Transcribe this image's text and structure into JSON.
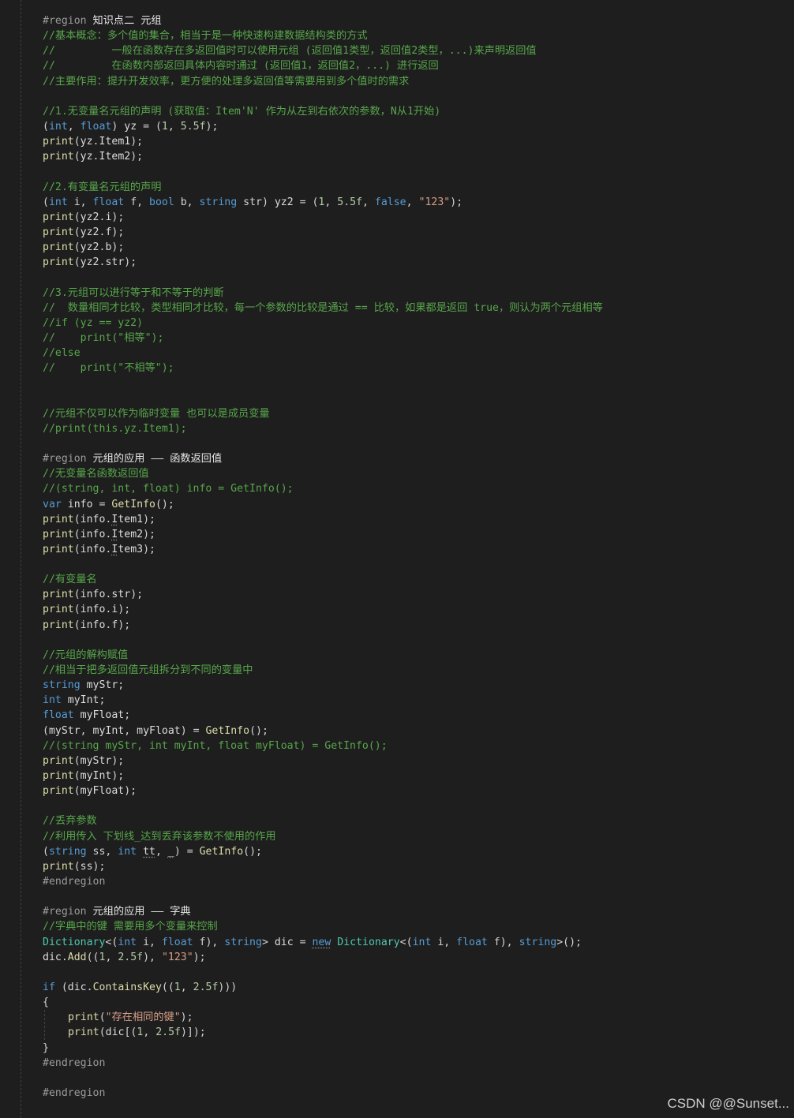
{
  "editor": {
    "lines": [
      {
        "type": "region",
        "prefix": "#region ",
        "name": "知识点二 元组"
      },
      {
        "type": "comment",
        "text": "//基本概念：多个值的集合，相当于是一种快速构建数据结构类的方式"
      },
      {
        "type": "comment",
        "text": "//         一般在函数存在多返回值时可以使用元组 (返回值1类型，返回值2类型，...)来声明返回值"
      },
      {
        "type": "comment",
        "text": "//         在函数内部返回具体内容时通过 (返回值1，返回值2，...) 进行返回"
      },
      {
        "type": "comment",
        "text": "//主要作用：提升开发效率，更方便的处理多返回值等需要用到多个值时的需求"
      },
      {
        "type": "blank"
      },
      {
        "type": "comment",
        "text": "//1.无变量名元组的声明 (获取值：Item'N' 作为从左到右依次的参数，N从1开始)"
      },
      {
        "type": "code",
        "tokens": [
          [
            "p",
            "("
          ],
          [
            "k",
            "int"
          ],
          [
            "p",
            ", "
          ],
          [
            "k",
            "float"
          ],
          [
            "p",
            ") "
          ],
          [
            "v",
            "yz"
          ],
          [
            "p",
            " = ("
          ],
          [
            "n",
            "1"
          ],
          [
            "p",
            ", "
          ],
          [
            "n",
            "5.5f"
          ],
          [
            "p",
            ");"
          ]
        ]
      },
      {
        "type": "code",
        "tokens": [
          [
            "f",
            "print"
          ],
          [
            "p",
            "("
          ],
          [
            "v",
            "yz"
          ],
          [
            "p",
            "."
          ],
          [
            "v",
            "Item1"
          ],
          [
            "p",
            ");"
          ]
        ]
      },
      {
        "type": "code",
        "tokens": [
          [
            "f",
            "print"
          ],
          [
            "p",
            "("
          ],
          [
            "v",
            "yz"
          ],
          [
            "p",
            "."
          ],
          [
            "v",
            "Item2"
          ],
          [
            "p",
            ");"
          ]
        ]
      },
      {
        "type": "blank"
      },
      {
        "type": "comment",
        "text": "//2.有变量名元组的声明"
      },
      {
        "type": "code",
        "tokens": [
          [
            "p",
            "("
          ],
          [
            "k",
            "int"
          ],
          [
            "p",
            " i, "
          ],
          [
            "k",
            "float"
          ],
          [
            "p",
            " f, "
          ],
          [
            "k",
            "bool"
          ],
          [
            "p",
            " b, "
          ],
          [
            "k",
            "string"
          ],
          [
            "p",
            " str) "
          ],
          [
            "v",
            "yz2"
          ],
          [
            "p",
            " = ("
          ],
          [
            "n",
            "1"
          ],
          [
            "p",
            ", "
          ],
          [
            "n",
            "5.5f"
          ],
          [
            "p",
            ", "
          ],
          [
            "k",
            "false"
          ],
          [
            "p",
            ", "
          ],
          [
            "s",
            "\"123\""
          ],
          [
            "p",
            ");"
          ]
        ]
      },
      {
        "type": "code",
        "tokens": [
          [
            "f",
            "print"
          ],
          [
            "p",
            "("
          ],
          [
            "v",
            "yz2"
          ],
          [
            "p",
            "."
          ],
          [
            "v",
            "i"
          ],
          [
            "p",
            ");"
          ]
        ]
      },
      {
        "type": "code",
        "tokens": [
          [
            "f",
            "print"
          ],
          [
            "p",
            "("
          ],
          [
            "v",
            "yz2"
          ],
          [
            "p",
            "."
          ],
          [
            "v",
            "f"
          ],
          [
            "p",
            ");"
          ]
        ]
      },
      {
        "type": "code",
        "tokens": [
          [
            "f",
            "print"
          ],
          [
            "p",
            "("
          ],
          [
            "v",
            "yz2"
          ],
          [
            "p",
            "."
          ],
          [
            "v",
            "b"
          ],
          [
            "p",
            ");"
          ]
        ]
      },
      {
        "type": "code",
        "tokens": [
          [
            "f",
            "print"
          ],
          [
            "p",
            "("
          ],
          [
            "v",
            "yz2"
          ],
          [
            "p",
            "."
          ],
          [
            "v",
            "str"
          ],
          [
            "p",
            ");"
          ]
        ]
      },
      {
        "type": "blank"
      },
      {
        "type": "comment",
        "text": "//3.元组可以进行等于和不等于的判断"
      },
      {
        "type": "comment",
        "text": "//  数量相同才比较，类型相同才比较，每一个参数的比较是通过 == 比较，如果都是返回 true，则认为两个元组相等"
      },
      {
        "type": "comment",
        "text": "//if (yz == yz2)"
      },
      {
        "type": "comment",
        "text": "//    print(\"相等\");"
      },
      {
        "type": "comment",
        "text": "//else"
      },
      {
        "type": "comment",
        "text": "//    print(\"不相等\");"
      },
      {
        "type": "blank"
      },
      {
        "type": "blank"
      },
      {
        "type": "comment",
        "text": "//元组不仅可以作为临时变量 也可以是成员变量"
      },
      {
        "type": "comment",
        "text": "//print(this.yz.Item1);"
      },
      {
        "type": "blank"
      },
      {
        "type": "region",
        "prefix": "#region ",
        "name": "元组的应用 —— 函数返回值"
      },
      {
        "type": "comment",
        "text": "//无变量名函数返回值"
      },
      {
        "type": "comment",
        "text": "//(string, int, float) info = GetInfo();"
      },
      {
        "type": "code",
        "tokens": [
          [
            "k",
            "var"
          ],
          [
            "p",
            " "
          ],
          [
            "v",
            "info"
          ],
          [
            "p",
            " = "
          ],
          [
            "f",
            "GetInfo"
          ],
          [
            "p",
            "();"
          ]
        ]
      },
      {
        "type": "code",
        "tokens": [
          [
            "f",
            "print"
          ],
          [
            "p",
            "("
          ],
          [
            "v",
            "info"
          ],
          [
            "p",
            "."
          ],
          [
            "vs",
            "I"
          ],
          [
            "v",
            "tem1"
          ],
          [
            "p",
            ");"
          ]
        ]
      },
      {
        "type": "code",
        "tokens": [
          [
            "f",
            "print"
          ],
          [
            "p",
            "("
          ],
          [
            "v",
            "info"
          ],
          [
            "p",
            "."
          ],
          [
            "vs",
            "I"
          ],
          [
            "v",
            "tem2"
          ],
          [
            "p",
            ");"
          ]
        ]
      },
      {
        "type": "code",
        "tokens": [
          [
            "f",
            "print"
          ],
          [
            "p",
            "("
          ],
          [
            "v",
            "info"
          ],
          [
            "p",
            "."
          ],
          [
            "vs",
            "I"
          ],
          [
            "v",
            "tem3"
          ],
          [
            "p",
            ");"
          ]
        ]
      },
      {
        "type": "blank"
      },
      {
        "type": "comment",
        "text": "//有变量名"
      },
      {
        "type": "code",
        "tokens": [
          [
            "f",
            "print"
          ],
          [
            "p",
            "("
          ],
          [
            "v",
            "info"
          ],
          [
            "p",
            "."
          ],
          [
            "v",
            "str"
          ],
          [
            "p",
            ");"
          ]
        ]
      },
      {
        "type": "code",
        "tokens": [
          [
            "f",
            "print"
          ],
          [
            "p",
            "("
          ],
          [
            "v",
            "info"
          ],
          [
            "p",
            "."
          ],
          [
            "v",
            "i"
          ],
          [
            "p",
            ");"
          ]
        ]
      },
      {
        "type": "code",
        "tokens": [
          [
            "f",
            "print"
          ],
          [
            "p",
            "("
          ],
          [
            "v",
            "info"
          ],
          [
            "p",
            "."
          ],
          [
            "v",
            "f"
          ],
          [
            "p",
            ");"
          ]
        ]
      },
      {
        "type": "blank"
      },
      {
        "type": "comment",
        "text": "//元组的解构赋值"
      },
      {
        "type": "comment",
        "text": "//相当于把多返回值元组拆分到不同的变量中"
      },
      {
        "type": "code",
        "tokens": [
          [
            "k",
            "string"
          ],
          [
            "p",
            " "
          ],
          [
            "v",
            "myStr"
          ],
          [
            "p",
            ";"
          ]
        ]
      },
      {
        "type": "code",
        "tokens": [
          [
            "k",
            "int"
          ],
          [
            "p",
            " "
          ],
          [
            "v",
            "myInt"
          ],
          [
            "p",
            ";"
          ]
        ]
      },
      {
        "type": "code",
        "tokens": [
          [
            "k",
            "float"
          ],
          [
            "p",
            " "
          ],
          [
            "v",
            "myFloat"
          ],
          [
            "p",
            ";"
          ]
        ]
      },
      {
        "type": "code",
        "tokens": [
          [
            "p",
            "("
          ],
          [
            "v",
            "myStr"
          ],
          [
            "p",
            ", "
          ],
          [
            "v",
            "myInt"
          ],
          [
            "p",
            ", "
          ],
          [
            "v",
            "myFloat"
          ],
          [
            "p",
            ") = "
          ],
          [
            "f",
            "GetInfo"
          ],
          [
            "p",
            "();"
          ]
        ]
      },
      {
        "type": "comment",
        "text": "//(string myStr, int myInt, float myFloat) = GetInfo();"
      },
      {
        "type": "code",
        "tokens": [
          [
            "f",
            "print"
          ],
          [
            "p",
            "("
          ],
          [
            "v",
            "myStr"
          ],
          [
            "p",
            ");"
          ]
        ]
      },
      {
        "type": "code",
        "tokens": [
          [
            "f",
            "print"
          ],
          [
            "p",
            "("
          ],
          [
            "v",
            "myInt"
          ],
          [
            "p",
            ");"
          ]
        ]
      },
      {
        "type": "code",
        "tokens": [
          [
            "f",
            "print"
          ],
          [
            "p",
            "("
          ],
          [
            "v",
            "myFloat"
          ],
          [
            "p",
            ");"
          ]
        ]
      },
      {
        "type": "blank"
      },
      {
        "type": "comment",
        "text": "//丢弃参数"
      },
      {
        "type": "comment",
        "text": "//利用传入 下划线_达到丢弃该参数不使用的作用"
      },
      {
        "type": "code",
        "tokens": [
          [
            "p",
            "("
          ],
          [
            "k",
            "string"
          ],
          [
            "p",
            " ss, "
          ],
          [
            "k",
            "int"
          ],
          [
            "p",
            " "
          ],
          [
            "vs",
            "tt"
          ],
          [
            "p",
            ", "
          ],
          [
            "vs",
            "_"
          ],
          [
            "p",
            ") = "
          ],
          [
            "f",
            "GetInfo"
          ],
          [
            "p",
            "();"
          ]
        ]
      },
      {
        "type": "code",
        "tokens": [
          [
            "f",
            "print"
          ],
          [
            "p",
            "("
          ],
          [
            "v",
            "ss"
          ],
          [
            "p",
            ");"
          ]
        ]
      },
      {
        "type": "region",
        "prefix": "#endregion",
        "name": ""
      },
      {
        "type": "blank"
      },
      {
        "type": "region",
        "prefix": "#region ",
        "name": "元组的应用 —— 字典"
      },
      {
        "type": "comment",
        "text": "//字典中的键 需要用多个变量来控制"
      },
      {
        "type": "code",
        "tokens": [
          [
            "t",
            "Dictionary"
          ],
          [
            "p",
            "<("
          ],
          [
            "k",
            "int"
          ],
          [
            "p",
            " i, "
          ],
          [
            "k",
            "float"
          ],
          [
            "p",
            " f), "
          ],
          [
            "k",
            "string"
          ],
          [
            "p",
            "> "
          ],
          [
            "v",
            "dic"
          ],
          [
            "p",
            " = "
          ],
          [
            "ks",
            "new"
          ],
          [
            "p",
            " "
          ],
          [
            "t",
            "Dictionary"
          ],
          [
            "p",
            "<("
          ],
          [
            "k",
            "int"
          ],
          [
            "p",
            " i, "
          ],
          [
            "k",
            "float"
          ],
          [
            "p",
            " f), "
          ],
          [
            "k",
            "string"
          ],
          [
            "p",
            ">();"
          ]
        ]
      },
      {
        "type": "code",
        "tokens": [
          [
            "v",
            "dic"
          ],
          [
            "p",
            "."
          ],
          [
            "f",
            "Add"
          ],
          [
            "p",
            "(("
          ],
          [
            "n",
            "1"
          ],
          [
            "p",
            ", "
          ],
          [
            "n",
            "2.5f"
          ],
          [
            "p",
            "), "
          ],
          [
            "s",
            "\"123\""
          ],
          [
            "p",
            ");"
          ]
        ]
      },
      {
        "type": "blank"
      },
      {
        "type": "code",
        "tokens": [
          [
            "k",
            "if"
          ],
          [
            "p",
            " ("
          ],
          [
            "v",
            "dic"
          ],
          [
            "p",
            "."
          ],
          [
            "f",
            "ContainsKey"
          ],
          [
            "p",
            "(("
          ],
          [
            "n",
            "1"
          ],
          [
            "p",
            ", "
          ],
          [
            "n",
            "2.5f"
          ],
          [
            "p",
            ")))"
          ]
        ]
      },
      {
        "type": "code",
        "tokens": [
          [
            "p",
            "{"
          ]
        ]
      },
      {
        "type": "code",
        "indent": 1,
        "tokens": [
          [
            "f",
            "print"
          ],
          [
            "p",
            "("
          ],
          [
            "s",
            "\"存在相同的键\""
          ],
          [
            "p",
            ");"
          ]
        ]
      },
      {
        "type": "code",
        "indent": 1,
        "tokens": [
          [
            "f",
            "print"
          ],
          [
            "p",
            "("
          ],
          [
            "v",
            "dic"
          ],
          [
            "p",
            "[("
          ],
          [
            "n",
            "1"
          ],
          [
            "p",
            ", "
          ],
          [
            "n",
            "2.5f"
          ],
          [
            "p",
            ")]);"
          ]
        ]
      },
      {
        "type": "code",
        "tokens": [
          [
            "p",
            "}"
          ]
        ]
      },
      {
        "type": "region",
        "prefix": "#endregion",
        "name": ""
      },
      {
        "type": "blank"
      },
      {
        "type": "region",
        "prefix": "#endregion",
        "name": ""
      }
    ]
  },
  "watermark": "CSDN @@Sunset...",
  "colors": {
    "background": "#1e1e1e",
    "comment": "#57a64a",
    "keyword": "#569cd6",
    "string": "#d69d85",
    "number": "#b5cea8",
    "type": "#4ec9b0",
    "function": "#dcdcaa",
    "text": "#d4d4d4",
    "region": "#9b9b9b"
  }
}
